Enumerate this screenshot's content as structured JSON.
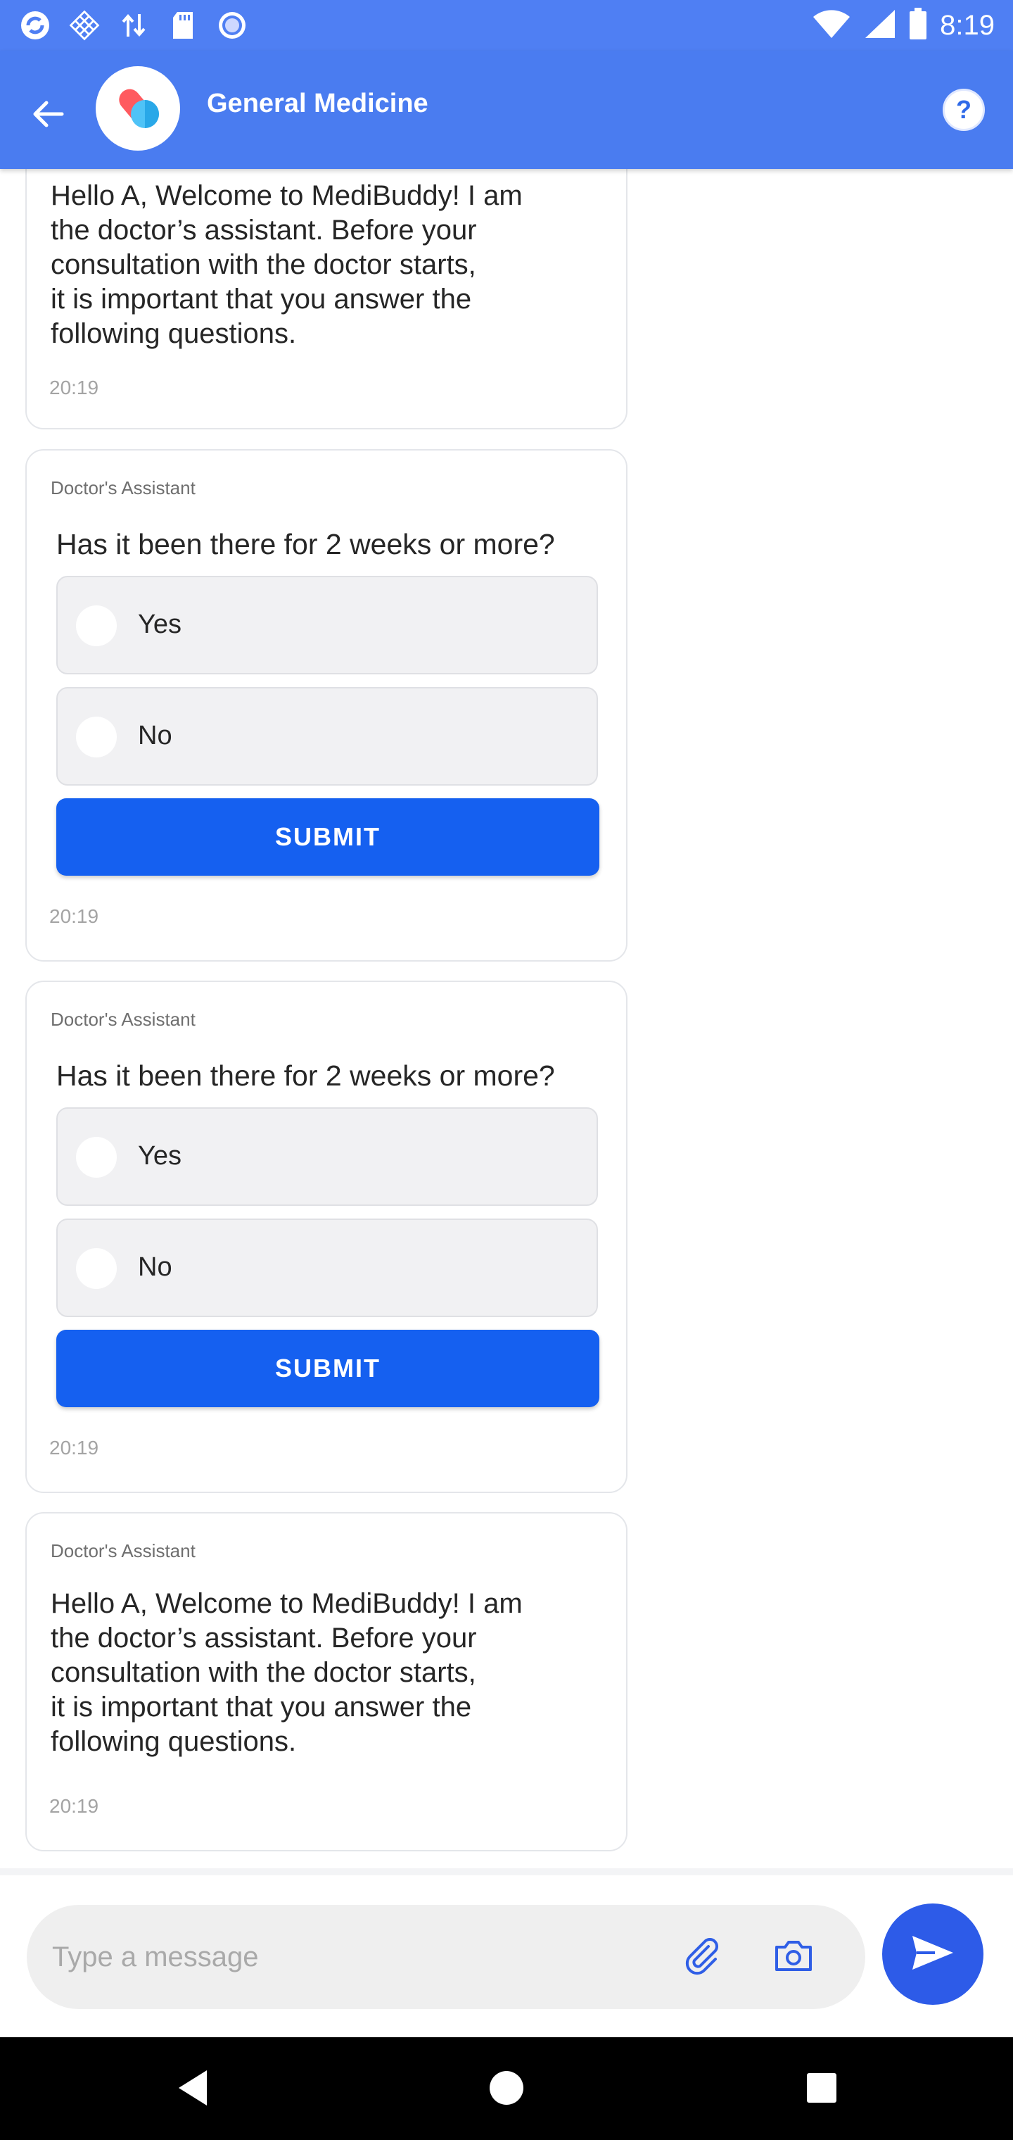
{
  "status_bar": {
    "time": "8:19",
    "icons": [
      "app-refresh-icon",
      "grid-icon",
      "data-transfer-icon",
      "sd-card-icon",
      "record-icon",
      "wifi-icon",
      "cell-signal-icon",
      "battery-icon"
    ]
  },
  "app_bar": {
    "title": "General Medicine",
    "help_label": "?"
  },
  "chat": {
    "messages": [
      {
        "type": "text",
        "text": "Hello A, Welcome to MediBuddy! I am\nthe doctor’s assistant. Before your\nconsultation with the doctor starts,\nit is important that you answer the\nfollowing questions.",
        "time": "20:19"
      },
      {
        "type": "question",
        "sender": "Doctor's Assistant",
        "question": "Has it been there for 2 weeks or more?",
        "options": [
          "Yes",
          "No"
        ],
        "submit_label": "SUBMIT",
        "time": "20:19"
      },
      {
        "type": "question",
        "sender": "Doctor's Assistant",
        "question": "Has it been there for 2 weeks or more?",
        "options": [
          "Yes",
          "No"
        ],
        "submit_label": "SUBMIT",
        "time": "20:19"
      },
      {
        "type": "text",
        "sender": "Doctor's Assistant",
        "text": "Hello A, Welcome to MediBuddy! I am\nthe doctor’s assistant. Before your\nconsultation with the doctor starts,\nit is important that you answer the\nfollowing questions.",
        "time": "20:19"
      }
    ]
  },
  "composer": {
    "placeholder": "Type a message",
    "value": ""
  },
  "colors": {
    "app_bar": "#4a7cf0",
    "submit": "#1560f0",
    "send": "#2d5be8"
  }
}
